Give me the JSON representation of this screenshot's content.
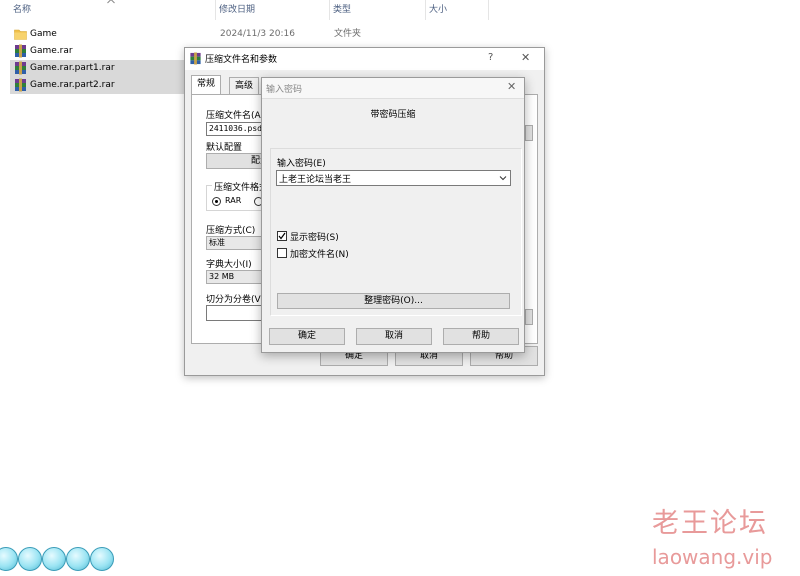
{
  "explorer": {
    "columns": [
      "名称",
      "修改日期",
      "类型",
      "大小"
    ],
    "rows": [
      {
        "name": "Game",
        "icon": "folder-icon",
        "date": "2024/11/3 20:16",
        "type": "文件夹",
        "selected": false
      },
      {
        "name": "Game.rar",
        "icon": "winrar-archive-icon",
        "selected": false
      },
      {
        "name": "Game.rar.part1.rar",
        "icon": "winrar-archive-icon",
        "selected": true
      },
      {
        "name": "Game.rar.part2.rar",
        "icon": "winrar-archive-icon",
        "selected": true
      }
    ]
  },
  "archive_dialog": {
    "title": "压缩文件名和参数",
    "help": "?",
    "close": "✕",
    "tabs": [
      "常规",
      "高级"
    ],
    "archive_name_label": "压缩文件名(A",
    "archive_name_value": "2411036.psd",
    "default_profile_label": "默认配置",
    "profile_button": "配置",
    "format_group_label": "压缩文件格式",
    "format_rar": "RAR",
    "method_label": "压缩方式(C)",
    "method_value": "标准",
    "dict_label": "字典大小(I)",
    "dict_value": "32 MB",
    "split_label": "切分为分卷(V",
    "ok": "确定",
    "cancel": "取消",
    "help_button": "帮助"
  },
  "password_dialog": {
    "title": "输入密码",
    "close": "✕",
    "heading": "带密码压缩",
    "enter_label": "输入密码(E)",
    "password_value": "上老王论坛当老王",
    "show_password": "显示密码(S)",
    "show_password_checked": true,
    "encrypt_names": "加密文件名(N)",
    "encrypt_names_checked": false,
    "organize_button": "整理密码(O)...",
    "ok": "确定",
    "cancel": "取消",
    "help": "帮助"
  },
  "watermark": {
    "cn": "老王论坛",
    "url": "laowang.vip"
  },
  "colors": {
    "selection": "#d9d9d9",
    "watermark": "#e89a9a",
    "folder": "#f0c04a"
  }
}
